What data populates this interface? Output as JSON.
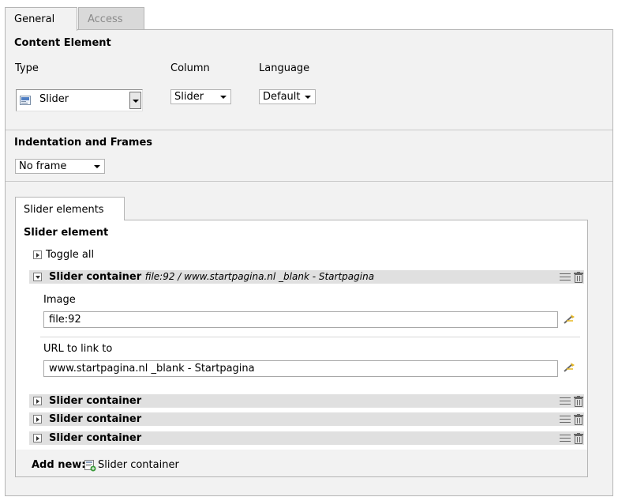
{
  "tabs": [
    {
      "label": "General",
      "active": true
    },
    {
      "label": "Access",
      "active": false
    }
  ],
  "content_element": {
    "title": "Content Element",
    "type_label": "Type",
    "type_value": "Slider",
    "column_label": "Column",
    "column_value": "Slider",
    "language_label": "Language",
    "language_value": "Default"
  },
  "indentation": {
    "title": "Indentation and Frames",
    "frame_value": "No frame"
  },
  "slider_tab": {
    "label": "Slider elements"
  },
  "slider_element": {
    "title": "Slider element",
    "toggle_all": "Toggle all",
    "containers": [
      {
        "title": "Slider container",
        "subtitle": "file:92 / www.startpagina.nl _blank - Startpagina",
        "expanded": true
      },
      {
        "title": "Slider container",
        "subtitle": "",
        "expanded": false
      },
      {
        "title": "Slider container",
        "subtitle": "",
        "expanded": false
      },
      {
        "title": "Slider container",
        "subtitle": "",
        "expanded": false
      }
    ],
    "image_label": "Image",
    "image_value": "file:92",
    "url_label": "URL to link to",
    "url_value": "www.startpagina.nl _blank - Startpagina",
    "add_new_label": "Add new:",
    "add_new_item": "Slider container"
  }
}
